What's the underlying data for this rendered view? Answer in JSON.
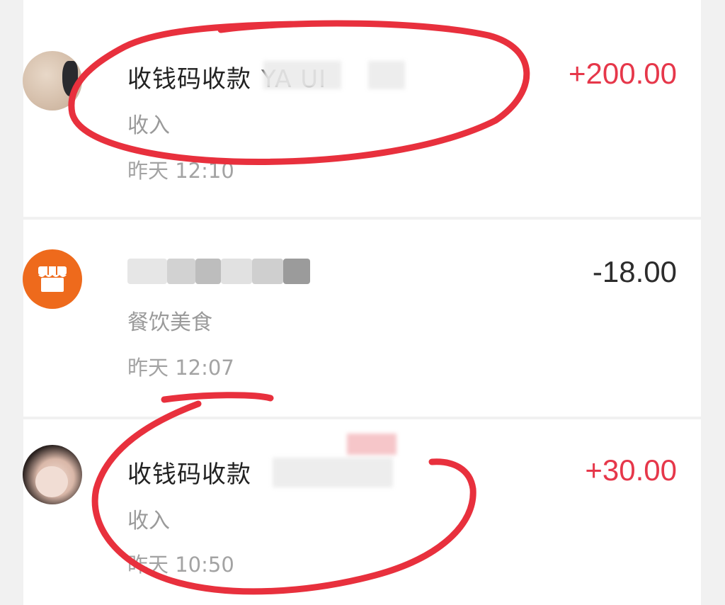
{
  "transactions": [
    {
      "title": "收钱码收款",
      "name_visible": "YA UI",
      "category": "收入",
      "time": "昨天 12:10",
      "amount": "+200.00",
      "type": "income"
    },
    {
      "title": "",
      "name_visible": "",
      "category": "餐饮美食",
      "time": "昨天 12:07",
      "amount": "-18.00",
      "type": "expense"
    },
    {
      "title": "收钱码收款",
      "name_visible": "",
      "category": "收入",
      "time": "昨天 10:50",
      "amount": "+30.00",
      "type": "income"
    }
  ],
  "colors": {
    "income": "#e6374a",
    "expense": "#2c2c2c",
    "annotation": "#e8303d",
    "shop_avatar": "#ee6a1c"
  },
  "icons": [
    "user-avatar",
    "shop-icon",
    "user-avatar"
  ]
}
